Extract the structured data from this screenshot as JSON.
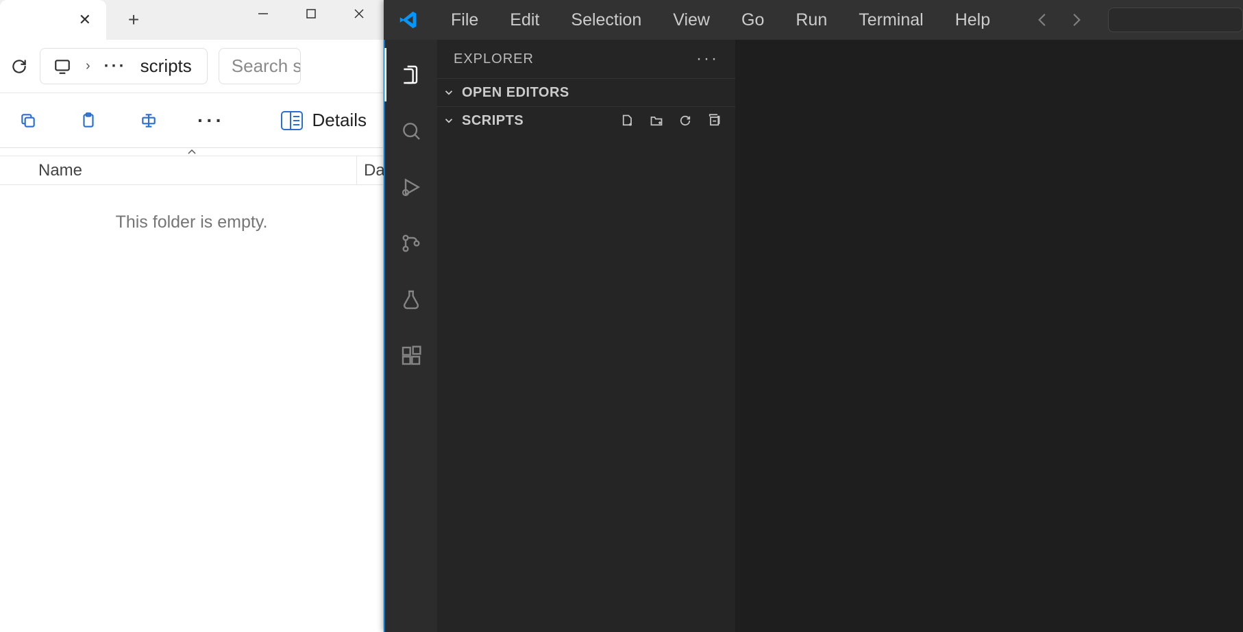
{
  "file_explorer": {
    "path_current": "scripts",
    "search_placeholder": "Search scri",
    "details_label": "Details",
    "columns": {
      "name": "Name",
      "date": "Da"
    },
    "empty_message": "This folder is empty."
  },
  "vscode": {
    "menu": {
      "file": "File",
      "edit": "Edit",
      "selection": "Selection",
      "view": "View",
      "go": "Go",
      "run": "Run",
      "terminal": "Terminal",
      "help": "Help"
    },
    "sidebar": {
      "title": "EXPLORER",
      "open_editors_label": "OPEN EDITORS",
      "folder_label": "SCRIPTS"
    },
    "activity": {
      "explorer": "explorer-icon",
      "search": "search-icon",
      "debug": "debug-icon",
      "scm": "source-control-icon",
      "testing": "testing-icon",
      "extensions": "extensions-icon"
    }
  }
}
